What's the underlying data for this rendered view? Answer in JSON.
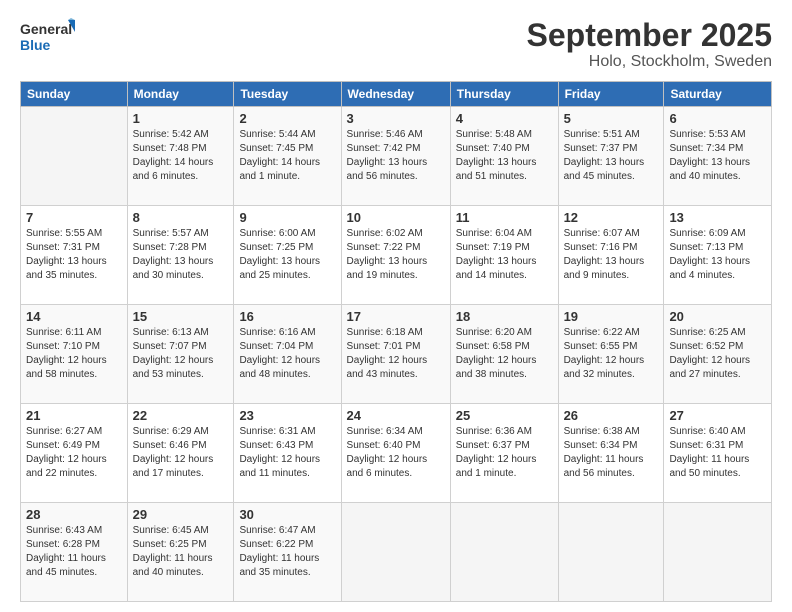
{
  "logo": {
    "line1": "General",
    "line2": "Blue"
  },
  "title": "September 2025",
  "subtitle": "Holo, Stockholm, Sweden",
  "days_header": [
    "Sunday",
    "Monday",
    "Tuesday",
    "Wednesday",
    "Thursday",
    "Friday",
    "Saturday"
  ],
  "weeks": [
    [
      {
        "day": "",
        "info": ""
      },
      {
        "day": "1",
        "info": "Sunrise: 5:42 AM\nSunset: 7:48 PM\nDaylight: 14 hours\nand 6 minutes."
      },
      {
        "day": "2",
        "info": "Sunrise: 5:44 AM\nSunset: 7:45 PM\nDaylight: 14 hours\nand 1 minute."
      },
      {
        "day": "3",
        "info": "Sunrise: 5:46 AM\nSunset: 7:42 PM\nDaylight: 13 hours\nand 56 minutes."
      },
      {
        "day": "4",
        "info": "Sunrise: 5:48 AM\nSunset: 7:40 PM\nDaylight: 13 hours\nand 51 minutes."
      },
      {
        "day": "5",
        "info": "Sunrise: 5:51 AM\nSunset: 7:37 PM\nDaylight: 13 hours\nand 45 minutes."
      },
      {
        "day": "6",
        "info": "Sunrise: 5:53 AM\nSunset: 7:34 PM\nDaylight: 13 hours\nand 40 minutes."
      }
    ],
    [
      {
        "day": "7",
        "info": "Sunrise: 5:55 AM\nSunset: 7:31 PM\nDaylight: 13 hours\nand 35 minutes."
      },
      {
        "day": "8",
        "info": "Sunrise: 5:57 AM\nSunset: 7:28 PM\nDaylight: 13 hours\nand 30 minutes."
      },
      {
        "day": "9",
        "info": "Sunrise: 6:00 AM\nSunset: 7:25 PM\nDaylight: 13 hours\nand 25 minutes."
      },
      {
        "day": "10",
        "info": "Sunrise: 6:02 AM\nSunset: 7:22 PM\nDaylight: 13 hours\nand 19 minutes."
      },
      {
        "day": "11",
        "info": "Sunrise: 6:04 AM\nSunset: 7:19 PM\nDaylight: 13 hours\nand 14 minutes."
      },
      {
        "day": "12",
        "info": "Sunrise: 6:07 AM\nSunset: 7:16 PM\nDaylight: 13 hours\nand 9 minutes."
      },
      {
        "day": "13",
        "info": "Sunrise: 6:09 AM\nSunset: 7:13 PM\nDaylight: 13 hours\nand 4 minutes."
      }
    ],
    [
      {
        "day": "14",
        "info": "Sunrise: 6:11 AM\nSunset: 7:10 PM\nDaylight: 12 hours\nand 58 minutes."
      },
      {
        "day": "15",
        "info": "Sunrise: 6:13 AM\nSunset: 7:07 PM\nDaylight: 12 hours\nand 53 minutes."
      },
      {
        "day": "16",
        "info": "Sunrise: 6:16 AM\nSunset: 7:04 PM\nDaylight: 12 hours\nand 48 minutes."
      },
      {
        "day": "17",
        "info": "Sunrise: 6:18 AM\nSunset: 7:01 PM\nDaylight: 12 hours\nand 43 minutes."
      },
      {
        "day": "18",
        "info": "Sunrise: 6:20 AM\nSunset: 6:58 PM\nDaylight: 12 hours\nand 38 minutes."
      },
      {
        "day": "19",
        "info": "Sunrise: 6:22 AM\nSunset: 6:55 PM\nDaylight: 12 hours\nand 32 minutes."
      },
      {
        "day": "20",
        "info": "Sunrise: 6:25 AM\nSunset: 6:52 PM\nDaylight: 12 hours\nand 27 minutes."
      }
    ],
    [
      {
        "day": "21",
        "info": "Sunrise: 6:27 AM\nSunset: 6:49 PM\nDaylight: 12 hours\nand 22 minutes."
      },
      {
        "day": "22",
        "info": "Sunrise: 6:29 AM\nSunset: 6:46 PM\nDaylight: 12 hours\nand 17 minutes."
      },
      {
        "day": "23",
        "info": "Sunrise: 6:31 AM\nSunset: 6:43 PM\nDaylight: 12 hours\nand 11 minutes."
      },
      {
        "day": "24",
        "info": "Sunrise: 6:34 AM\nSunset: 6:40 PM\nDaylight: 12 hours\nand 6 minutes."
      },
      {
        "day": "25",
        "info": "Sunrise: 6:36 AM\nSunset: 6:37 PM\nDaylight: 12 hours\nand 1 minute."
      },
      {
        "day": "26",
        "info": "Sunrise: 6:38 AM\nSunset: 6:34 PM\nDaylight: 11 hours\nand 56 minutes."
      },
      {
        "day": "27",
        "info": "Sunrise: 6:40 AM\nSunset: 6:31 PM\nDaylight: 11 hours\nand 50 minutes."
      }
    ],
    [
      {
        "day": "28",
        "info": "Sunrise: 6:43 AM\nSunset: 6:28 PM\nDaylight: 11 hours\nand 45 minutes."
      },
      {
        "day": "29",
        "info": "Sunrise: 6:45 AM\nSunset: 6:25 PM\nDaylight: 11 hours\nand 40 minutes."
      },
      {
        "day": "30",
        "info": "Sunrise: 6:47 AM\nSunset: 6:22 PM\nDaylight: 11 hours\nand 35 minutes."
      },
      {
        "day": "",
        "info": ""
      },
      {
        "day": "",
        "info": ""
      },
      {
        "day": "",
        "info": ""
      },
      {
        "day": "",
        "info": ""
      }
    ]
  ]
}
